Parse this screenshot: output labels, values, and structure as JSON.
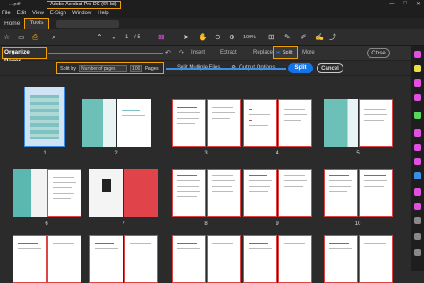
{
  "titlebar": {
    "file_name": "....pdf",
    "app_title": "Adobe Acrobat Pro DC (64-bit)",
    "min": "—",
    "max": "□",
    "close": "✕"
  },
  "menu": [
    "File",
    "Edit",
    "View",
    "E-Sign",
    "Window",
    "Help"
  ],
  "tabs": {
    "home": "Home",
    "tools": "Tools"
  },
  "toolbar": {
    "page_current": "1",
    "page_total": "/ 5",
    "zoom": "100%"
  },
  "organize": {
    "title": "Organize Pages",
    "insert": "Insert",
    "extract": "Extract",
    "replace": "Replace",
    "split": "Split",
    "more": "More",
    "close": "Close"
  },
  "split": {
    "split_by": "Split by",
    "method": "Number of pages",
    "count": "100",
    "pages": "Pages",
    "multiple": "Split Multiple Files",
    "output": "Output Options",
    "split_btn": "Split",
    "cancel": "Cancel"
  },
  "pages": [
    {
      "n": "1"
    },
    {
      "n": "2"
    },
    {
      "n": "3"
    },
    {
      "n": "4"
    },
    {
      "n": "5"
    },
    {
      "n": "6"
    },
    {
      "n": "7"
    },
    {
      "n": "8"
    },
    {
      "n": "9"
    },
    {
      "n": "10"
    }
  ],
  "colors": {
    "accent": "#f0a000",
    "blue": "#1473e6",
    "red_border": "#d44"
  }
}
